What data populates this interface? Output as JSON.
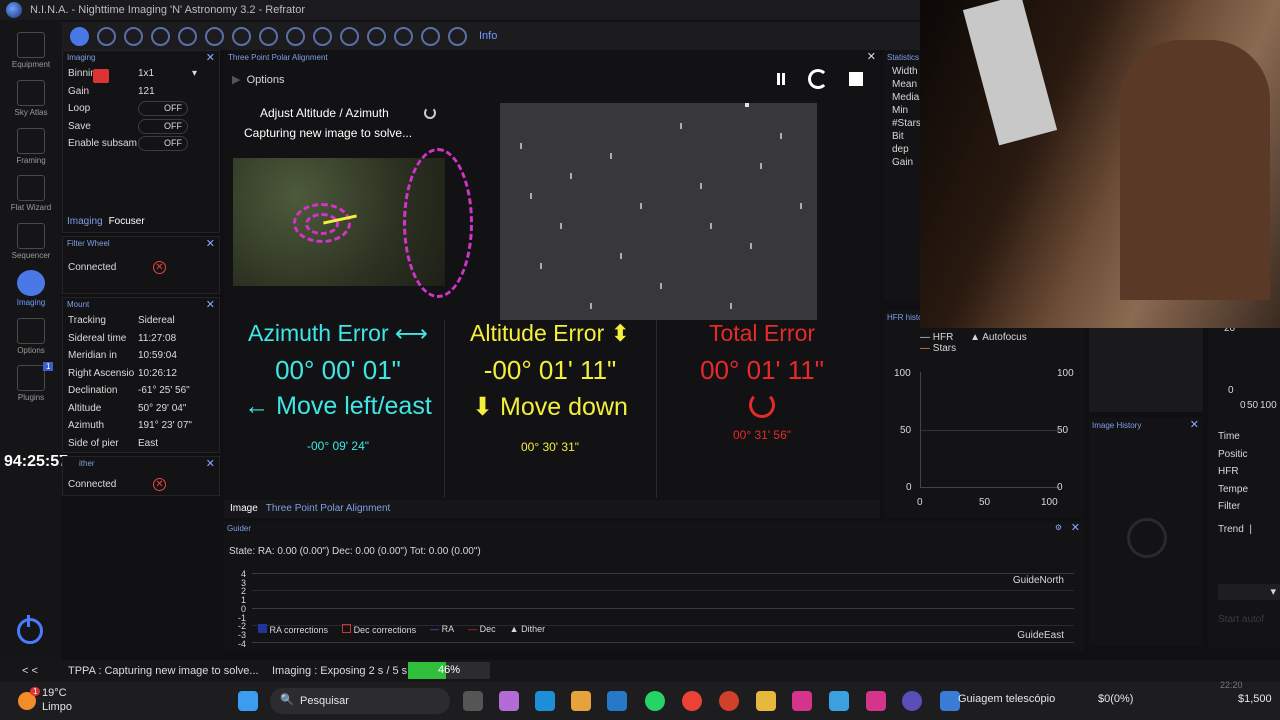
{
  "window": {
    "title": "N.I.N.A. - Nighttime Imaging 'N' Astronomy 3.2  -  Refrator"
  },
  "nav": [
    {
      "label": "Equipment"
    },
    {
      "label": "Sky Atlas"
    },
    {
      "label": "Framing"
    },
    {
      "label": "Flat Wizard"
    },
    {
      "label": "Sequencer"
    },
    {
      "label": "Imaging"
    },
    {
      "label": "Options"
    },
    {
      "label": "Plugins"
    }
  ],
  "nav_badge": "1",
  "toolbar": {
    "info_label": "Info"
  },
  "imaging_panel": {
    "title": "Imaging",
    "rows": [
      {
        "key": "Binning",
        "value": "1x1"
      },
      {
        "key": "Gain",
        "value": "121"
      },
      {
        "key": "Loop",
        "value": "OFF"
      },
      {
        "key": "Save",
        "value": "OFF"
      },
      {
        "key": "Enable subsam",
        "value": "OFF"
      }
    ],
    "tabs": [
      "Imaging",
      "Focuser"
    ]
  },
  "filter_wheel": {
    "title": "Filter Wheel",
    "status": "Connected"
  },
  "mount": {
    "title": "Mount",
    "rows": [
      {
        "key": "Tracking",
        "value": "Sidereal"
      },
      {
        "key": "Sidereal time",
        "value": "11:27:08"
      },
      {
        "key": "Meridian in",
        "value": "10:59:04"
      },
      {
        "key": "Right Ascensio",
        "value": "10:26:12"
      },
      {
        "key": "Declination",
        "value": "-61° 25' 56\""
      },
      {
        "key": "Altitude",
        "value": "50° 29' 04\""
      },
      {
        "key": "Azimuth",
        "value": "191° 23' 07\""
      },
      {
        "key": "Side of pier",
        "value": "East"
      }
    ]
  },
  "overlay_clock": "94:25:57",
  "weather": {
    "title": "ither",
    "status": "Connected"
  },
  "tppa": {
    "title": "Three Point Polar Alignment",
    "options_label": "Options",
    "step_label": "Adjust Altitude / Azimuth",
    "status": "Capturing new image to solve...",
    "azimuth": {
      "title": "Azimuth Error ⟷",
      "value": "00° 00' 01\"",
      "move": "← Move left/east",
      "small": "-00° 09' 24\""
    },
    "altitude": {
      "title": "Altitude Error ⬍",
      "value": "-00° 01' 11\"",
      "move": "⬇ Move down",
      "small": "00° 30' 31\""
    },
    "total": {
      "title": "Total Error",
      "value": "00° 01' 11\"",
      "small": "00° 31' 56\""
    },
    "colors": {
      "azimuth": "#3fe6e6",
      "altitude": "#f3ef3c",
      "total": "#e62a2a"
    }
  },
  "bottom_tabs": [
    "Image",
    "Three Point Polar Alignment"
  ],
  "statistics": {
    "title": "Statistics",
    "rows": [
      "Width",
      "Mean",
      "Media",
      "Min",
      "#Stars",
      "Bit dep",
      "Gain"
    ]
  },
  "hfr": {
    "title": "HFR histo",
    "legend": [
      "HFR",
      "Autofocus",
      "Stars"
    ],
    "y_ticks": [
      "100",
      "50",
      "0"
    ],
    "x_ticks": [
      "0",
      "50",
      "100"
    ]
  },
  "right_axis": {
    "y_ticks": [
      "20",
      "0"
    ],
    "x_ticks": [
      "0",
      "50",
      "100"
    ]
  },
  "image_history": {
    "title": "Image History"
  },
  "right_labels": [
    "Time",
    "Positic",
    "HFR",
    "Tempe",
    "Filter"
  ],
  "trend_label": "Trend",
  "start_autofocus": "Start autof",
  "guider": {
    "title": "Guider",
    "state": "State:  RA: 0.00 (0.00\")  Dec: 0.00 (0.00\")  Tot: 0.00 (0.00\")",
    "y_ticks": [
      "4",
      "3",
      "2",
      "1",
      "0",
      "-1",
      "-2",
      "-3",
      "-4"
    ],
    "north": "GuideNorth",
    "east": "GuideEast",
    "legend": [
      "RA corrections",
      "Dec corrections",
      "RA",
      "Dec",
      "Dither"
    ]
  },
  "status_bar": {
    "collapse": "< <",
    "tppa": "TPPA :   Capturing new image to solve...",
    "imaging": "Imaging :   Exposing 2 s / 5 s",
    "progress_percent": 46,
    "progress_label": "46%"
  },
  "taskbar": {
    "temp": "19°C",
    "weather": "Limpo",
    "weather_badge": "1",
    "search": "Pesquisar",
    "active_app": "Guiagem telescópio",
    "price1": "$0(0%)",
    "price2": "$1,500",
    "clock_small": "22:20"
  }
}
